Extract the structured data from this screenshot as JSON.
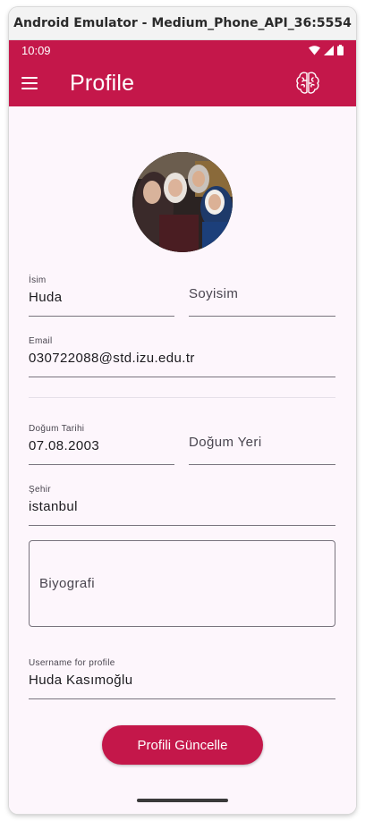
{
  "window": {
    "title": "Android Emulator - Medium_Phone_API_36:5554"
  },
  "status_bar": {
    "time": "10:09",
    "icons": [
      "wifi-icon",
      "signal-icon",
      "battery-icon"
    ]
  },
  "app_bar": {
    "title": "Profile",
    "menu_icon": "hamburger-menu-icon",
    "logo_icon": "brain-icon"
  },
  "colors": {
    "primary": "#c4174a",
    "background": "#fdf6fc",
    "underline": "#79747e"
  },
  "profile": {
    "name": {
      "label": "İsim",
      "value": "Huda"
    },
    "surname": {
      "placeholder": "Soyisim"
    },
    "email": {
      "label": "Email",
      "value": "030722088@std.izu.edu.tr"
    },
    "birth_date": {
      "label": "Doğum Tarihi",
      "value": "07.08.2003"
    },
    "birth_place": {
      "placeholder": "Doğum Yeri"
    },
    "city": {
      "label": "Şehir",
      "value": "istanbul"
    },
    "bio": {
      "placeholder": "Biyografi"
    },
    "username": {
      "label": "Username for profile",
      "value": "Huda Kasımoğlu"
    }
  },
  "actions": {
    "update_label": "Profili Güncelle"
  }
}
